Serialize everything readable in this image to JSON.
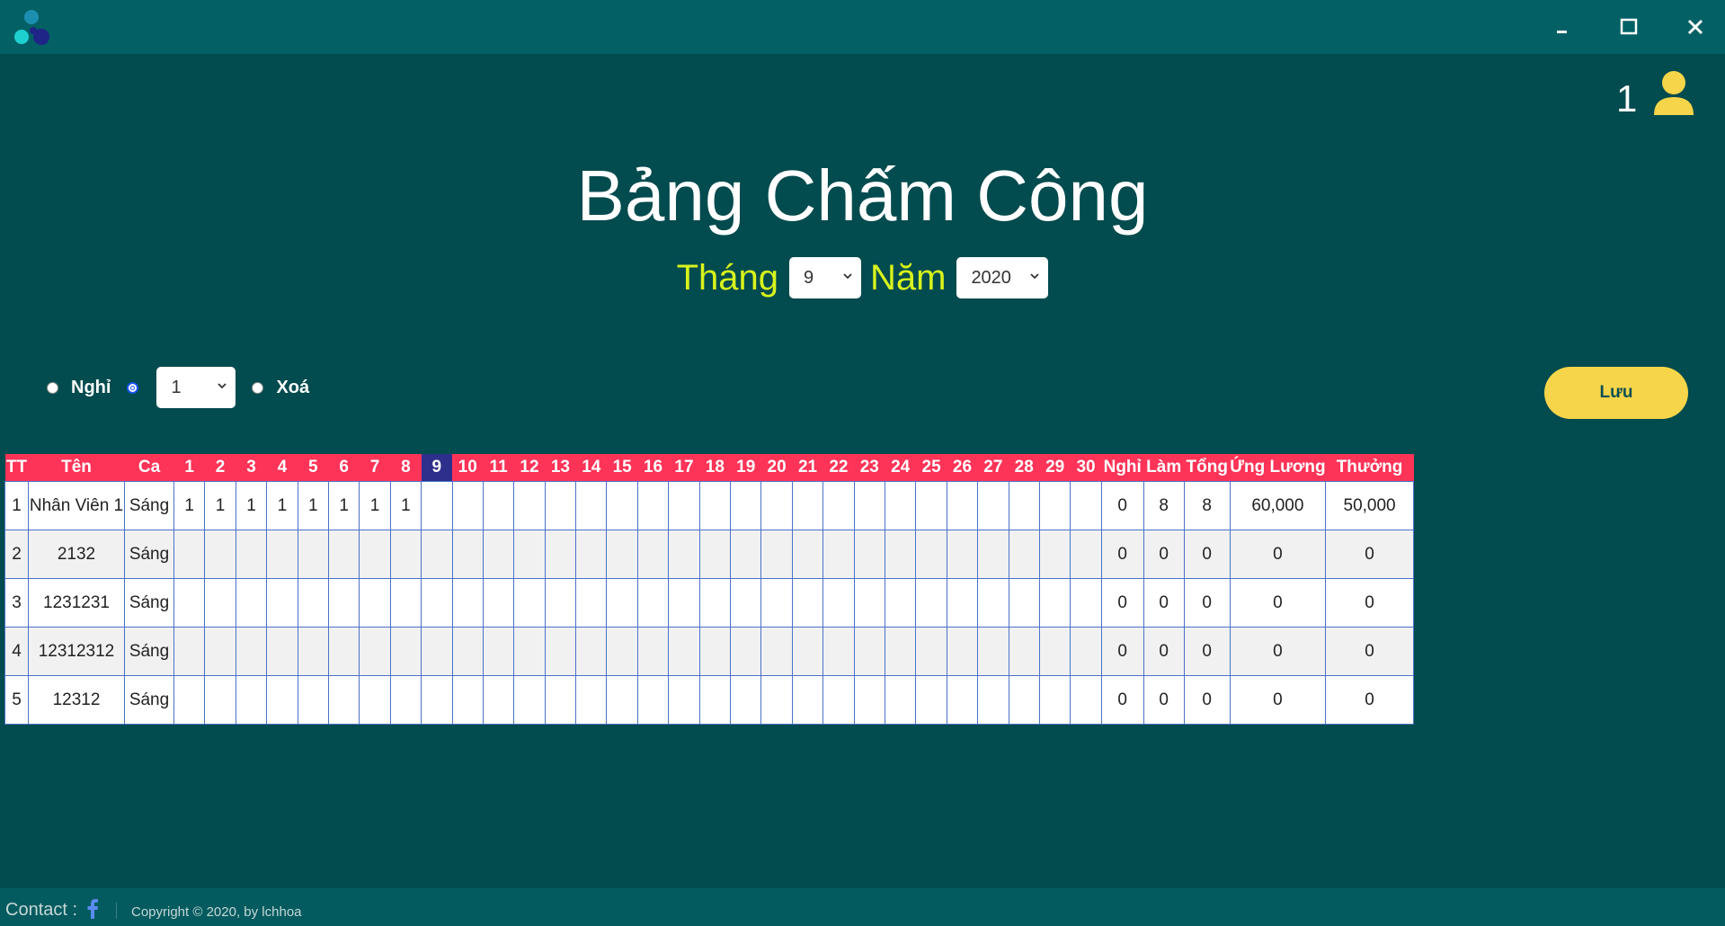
{
  "window": {
    "logo_icon": "tri-circle-logo",
    "minimize_icon": "minimize-icon",
    "maximize_icon": "maximize-icon",
    "close_icon": "close-icon",
    "titlebar_color": "#036165"
  },
  "user": {
    "count": "1",
    "icon": "user-icon",
    "icon_color": "#f6d54a"
  },
  "page": {
    "title": "Bảng Chấm Công"
  },
  "period": {
    "month_label": "Tháng",
    "month_value": "9",
    "year_label": "Năm",
    "year_value": "2020"
  },
  "toolbar": {
    "off_label": "Nghỉ",
    "shift_value": "1",
    "delete_label": "Xoá",
    "selected_option": "shift",
    "save_label": "Lưu",
    "save_color": "#f6d54a"
  },
  "table": {
    "highlight_day": "9",
    "header_color": "#fd3357",
    "headers": {
      "tt": "TT",
      "name": "Tên",
      "shift": "Ca",
      "days": [
        "1",
        "2",
        "3",
        "4",
        "5",
        "6",
        "7",
        "8",
        "9",
        "10",
        "11",
        "12",
        "13",
        "14",
        "15",
        "16",
        "17",
        "18",
        "19",
        "20",
        "21",
        "22",
        "23",
        "24",
        "25",
        "26",
        "27",
        "28",
        "29",
        "30"
      ],
      "off": "Nghỉ",
      "work": "Làm",
      "total": "Tổng",
      "advance": "Ứng Lương",
      "bonus": "Thưởng"
    },
    "rows": [
      {
        "tt": "1",
        "name": "Nhân Viên 1",
        "shift": "Sáng",
        "days": [
          "1",
          "1",
          "1",
          "1",
          "1",
          "1",
          "1",
          "1",
          "",
          "",
          "",
          "",
          "",
          "",
          "",
          "",
          "",
          "",
          "",
          "",
          "",
          "",
          "",
          "",
          "",
          "",
          "",
          "",
          "",
          ""
        ],
        "off": "0",
        "work": "8",
        "total": "8",
        "advance": "60,000",
        "bonus": "50,000"
      },
      {
        "tt": "2",
        "name": "2132",
        "shift": "Sáng",
        "days": [
          "",
          "",
          "",
          "",
          "",
          "",
          "",
          "",
          "",
          "",
          "",
          "",
          "",
          "",
          "",
          "",
          "",
          "",
          "",
          "",
          "",
          "",
          "",
          "",
          "",
          "",
          "",
          "",
          "",
          ""
        ],
        "off": "0",
        "work": "0",
        "total": "0",
        "advance": "0",
        "bonus": "0"
      },
      {
        "tt": "3",
        "name": "1231231",
        "shift": "Sáng",
        "days": [
          "",
          "",
          "",
          "",
          "",
          "",
          "",
          "",
          "",
          "",
          "",
          "",
          "",
          "",
          "",
          "",
          "",
          "",
          "",
          "",
          "",
          "",
          "",
          "",
          "",
          "",
          "",
          "",
          "",
          ""
        ],
        "off": "0",
        "work": "0",
        "total": "0",
        "advance": "0",
        "bonus": "0"
      },
      {
        "tt": "4",
        "name": "12312312",
        "shift": "Sáng",
        "days": [
          "",
          "",
          "",
          "",
          "",
          "",
          "",
          "",
          "",
          "",
          "",
          "",
          "",
          "",
          "",
          "",
          "",
          "",
          "",
          "",
          "",
          "",
          "",
          "",
          "",
          "",
          "",
          "",
          "",
          ""
        ],
        "off": "0",
        "work": "0",
        "total": "0",
        "advance": "0",
        "bonus": "0"
      },
      {
        "tt": "5",
        "name": "12312",
        "shift": "Sáng",
        "days": [
          "",
          "",
          "",
          "",
          "",
          "",
          "",
          "",
          "",
          "",
          "",
          "",
          "",
          "",
          "",
          "",
          "",
          "",
          "",
          "",
          "",
          "",
          "",
          "",
          "",
          "",
          "",
          "",
          "",
          ""
        ],
        "off": "0",
        "work": "0",
        "total": "0",
        "advance": "0",
        "bonus": "0"
      }
    ]
  },
  "footer": {
    "contact_label": "Contact :",
    "facebook_icon": "facebook-icon",
    "copyright": "Copyright © 2020, by lchhoa"
  }
}
